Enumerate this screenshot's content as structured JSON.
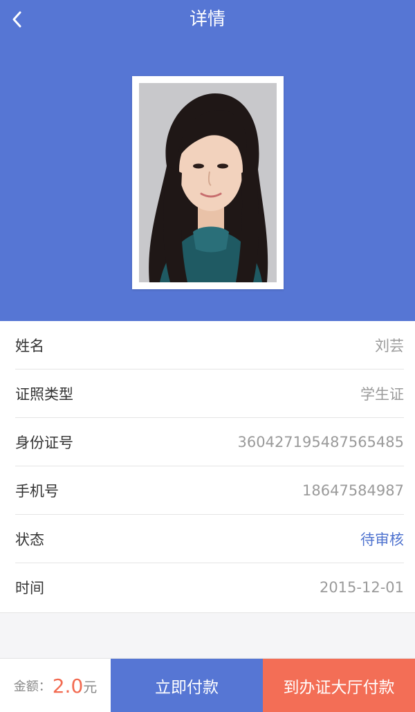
{
  "header": {
    "title": "详情",
    "back_icon": "chevron-left-icon",
    "background_color": "#5676d4"
  },
  "profile": {
    "photo": "portrait-photo"
  },
  "details": [
    {
      "label": "姓名",
      "value": "刘芸"
    },
    {
      "label": "证照类型",
      "value": "学生证"
    },
    {
      "label": "身份证号",
      "value": "360427195487565485"
    },
    {
      "label": "手机号",
      "value": "18647584987"
    },
    {
      "label": "状态",
      "value": "待审核",
      "value_color": "#4f73cf"
    },
    {
      "label": "时间",
      "value": "2015-12-01"
    }
  ],
  "footer": {
    "amount_label": "金额：",
    "amount_value": "2.0",
    "amount_unit": "元",
    "pay_now_label": "立即付款",
    "pay_hall_label": "到办证大厅付款",
    "pay_now_color": "#5676d4",
    "pay_hall_color": "#f36e56",
    "amount_color": "#f26a50"
  }
}
